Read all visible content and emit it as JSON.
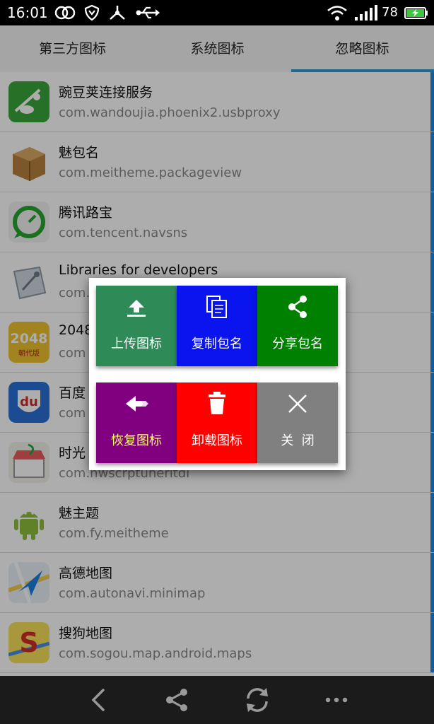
{
  "status_bar": {
    "time": "16:01",
    "battery": "78",
    "icons": [
      "link-icon",
      "shield-icon",
      "usb-debug-icon",
      "usb-icon",
      "wifi-icon",
      "signal-icon",
      "battery-charging-icon"
    ]
  },
  "tabs": {
    "items": [
      {
        "label": "第三方图标"
      },
      {
        "label": "系统图标"
      },
      {
        "label": "忽略图标"
      }
    ],
    "selected": "忽略图标"
  },
  "list": {
    "items": [
      {
        "name": "豌豆荚连接服务",
        "package": "com.wandoujia.phoenix2.usbproxy",
        "icon": "wandoujia-icon"
      },
      {
        "name": "魅包名",
        "package": "com.meitheme.packageview",
        "icon": "package-box-icon"
      },
      {
        "name": "腾讯路宝",
        "package": "com.tencent.navsns",
        "icon": "tencent-lubao-icon"
      },
      {
        "name": "Libraries for developers",
        "package": "com.",
        "icon": "libraries-icon"
      },
      {
        "name": "2048",
        "package": "com",
        "icon": "game-2048-icon",
        "icon_text": "2048",
        "icon_subtext": "朝代版"
      },
      {
        "name": "百度",
        "package": "com",
        "icon": "baidu-du-icon",
        "icon_text": "du"
      },
      {
        "name": "时光",
        "package": "com.hwscrptuneritdi",
        "icon": "shop-icon"
      },
      {
        "name": "魅主题",
        "package": "com.fy.meitheme",
        "icon": "android-icon"
      },
      {
        "name": "高德地图",
        "package": "com.autonavi.minimap",
        "icon": "amap-icon"
      },
      {
        "name": "搜狗地图",
        "package": "com.sogou.map.android.maps",
        "icon": "sogou-map-icon",
        "icon_text": "S"
      }
    ]
  },
  "dialog": {
    "tiles": [
      {
        "label": "上传图标",
        "icon": "upload-icon",
        "color": "#2e8b57"
      },
      {
        "label": "复制包名",
        "icon": "copy-icon",
        "color": "#0a14ee"
      },
      {
        "label": "分享包名",
        "icon": "share-icon",
        "color": "#008000"
      },
      {
        "label": "恢复图标",
        "icon": "restore-arrow-icon",
        "color": "#800080",
        "label_color": "#ffff66"
      },
      {
        "label": "卸载图标",
        "icon": "trash-icon",
        "color": "#ff0000"
      },
      {
        "label": "关  闭",
        "icon": "close-icon",
        "color": "#808080"
      }
    ]
  },
  "nav_bar": {
    "icons": [
      "back-icon",
      "share-icon",
      "refresh-icon",
      "more-icon"
    ]
  },
  "colors": {
    "tab_indicator": "#2a9bd8",
    "row_accent": "#1e88e5"
  }
}
